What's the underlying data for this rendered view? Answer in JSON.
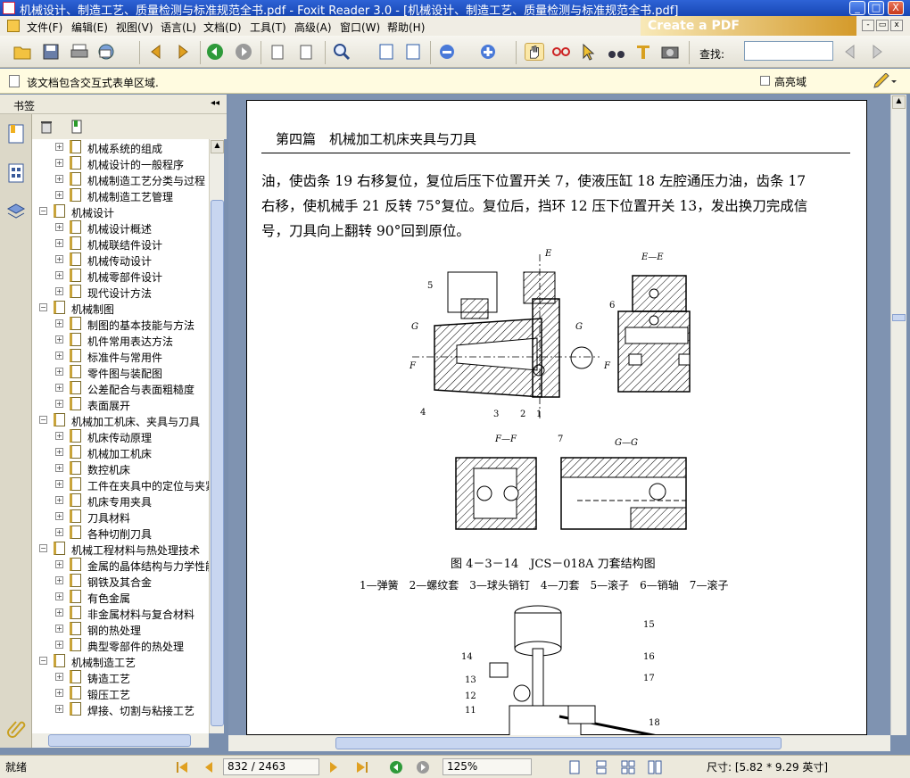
{
  "window": {
    "title": "机械设计、制造工艺、质量检测与标准规范全书.pdf - Foxit Reader 3.0 - [机械设计、制造工艺、质量检测与标准规范全书.pdf]",
    "minimize": "_",
    "maximize": "□",
    "close": "X"
  },
  "menu": [
    "文件(F)",
    "编辑(E)",
    "视图(V)",
    "语言(L)",
    "文档(D)",
    "工具(T)",
    "高级(A)",
    "窗口(W)",
    "帮助(H)"
  ],
  "ad_banner": "Create a PDF",
  "mdi": {
    "min": "-",
    "restore": "▭",
    "close": "x"
  },
  "toolbar": {
    "find_label": "查找:",
    "find_value": ""
  },
  "infobar": {
    "message": "该文档包含交互式表单区域.",
    "highlight_label": "高亮域"
  },
  "sidebar": {
    "title": "书签",
    "collapse": "◂◂"
  },
  "bookmarks": [
    {
      "level": 1,
      "label": "机械系统的组成",
      "expanded": false
    },
    {
      "level": 1,
      "label": "机械设计的一般程序",
      "expanded": false
    },
    {
      "level": 1,
      "label": "机械制造工艺分类与过程",
      "expanded": false
    },
    {
      "level": 1,
      "label": "机械制造工艺管理",
      "expanded": false
    },
    {
      "level": 0,
      "label": "机械设计",
      "expanded": true
    },
    {
      "level": 1,
      "label": "机械设计概述",
      "expanded": false
    },
    {
      "level": 1,
      "label": "机械联结件设计",
      "expanded": false
    },
    {
      "level": 1,
      "label": "机械传动设计",
      "expanded": false
    },
    {
      "level": 1,
      "label": "机械零部件设计",
      "expanded": false
    },
    {
      "level": 1,
      "label": "现代设计方法",
      "expanded": false
    },
    {
      "level": 0,
      "label": "机械制图",
      "expanded": true
    },
    {
      "level": 1,
      "label": "制图的基本技能与方法",
      "expanded": false
    },
    {
      "level": 1,
      "label": "机件常用表达方法",
      "expanded": false
    },
    {
      "level": 1,
      "label": "标准件与常用件",
      "expanded": false
    },
    {
      "level": 1,
      "label": "零件图与装配图",
      "expanded": false
    },
    {
      "level": 1,
      "label": "公差配合与表面粗糙度",
      "expanded": false
    },
    {
      "level": 1,
      "label": "表面展开",
      "expanded": false
    },
    {
      "level": 0,
      "label": "机械加工机床、夹具与刀具",
      "expanded": true
    },
    {
      "level": 1,
      "label": "机床传动原理",
      "expanded": false
    },
    {
      "level": 1,
      "label": "机械加工机床",
      "expanded": false
    },
    {
      "level": 1,
      "label": "数控机床",
      "expanded": false
    },
    {
      "level": 1,
      "label": "工件在夹具中的定位与夹紧",
      "expanded": false
    },
    {
      "level": 1,
      "label": "机床专用夹具",
      "expanded": false
    },
    {
      "level": 1,
      "label": "刀具材料",
      "expanded": false
    },
    {
      "level": 1,
      "label": "各种切削刀具",
      "expanded": false
    },
    {
      "level": 0,
      "label": "机械工程材料与热处理技术",
      "expanded": true
    },
    {
      "level": 1,
      "label": "金属的晶体结构与力学性能",
      "expanded": false
    },
    {
      "level": 1,
      "label": "钢铁及其合金",
      "expanded": false
    },
    {
      "level": 1,
      "label": "有色金属",
      "expanded": false
    },
    {
      "level": 1,
      "label": "非金属材料与复合材料",
      "expanded": false
    },
    {
      "level": 1,
      "label": "钢的热处理",
      "expanded": false
    },
    {
      "level": 1,
      "label": "典型零部件的热处理",
      "expanded": false
    },
    {
      "level": 0,
      "label": "机械制造工艺",
      "expanded": true
    },
    {
      "level": 1,
      "label": "铸造工艺",
      "expanded": false
    },
    {
      "level": 1,
      "label": "锻压工艺",
      "expanded": false
    },
    {
      "level": 1,
      "label": "焊接、切割与粘接工艺",
      "expanded": false
    }
  ],
  "page": {
    "header": "第四篇　机械加工机床夹具与刀具",
    "paragraph": [
      "油，使齿条 19 右移复位，复位后压下位置开关 7，使液压缸 18 左腔通压力油，齿条 17",
      "右移，使机械手 21 反转 75°复位。复位后，挡环 12 压下位置开关 13，发出换刀完成信",
      "号，刀具向上翻转 90°回到原位。"
    ],
    "figure1": {
      "caption": "图 4－3－14　JCS－018A 刀套结构图",
      "legend": "1—弹簧　2—螺纹套　3—球头销钉　4—刀套　5—滚子　6—销轴　7—滚子",
      "labels": {
        "e_top": "E",
        "ee": "E—E",
        "ff": "F—F",
        "gg": "G—G",
        "g_left": "G",
        "g_right": "G",
        "f_left": "F",
        "f_right": "F",
        "n1": "1",
        "n2": "2",
        "n3": "3",
        "n4": "4",
        "n5": "5",
        "n6": "6",
        "n7": "7"
      }
    },
    "figure2": {
      "labels": [
        "15",
        "14",
        "16",
        "13",
        "12",
        "17",
        "11",
        "18"
      ]
    }
  },
  "status": {
    "ready": "就绪",
    "page_display": "832 / 2463",
    "zoom": "125%",
    "size": "尺寸: [5.82 * 9.29 英寸]"
  },
  "colors": {
    "titlebar": "#1f50c4",
    "infobar": "#fffbe0",
    "docbg": "#7f93b1"
  }
}
